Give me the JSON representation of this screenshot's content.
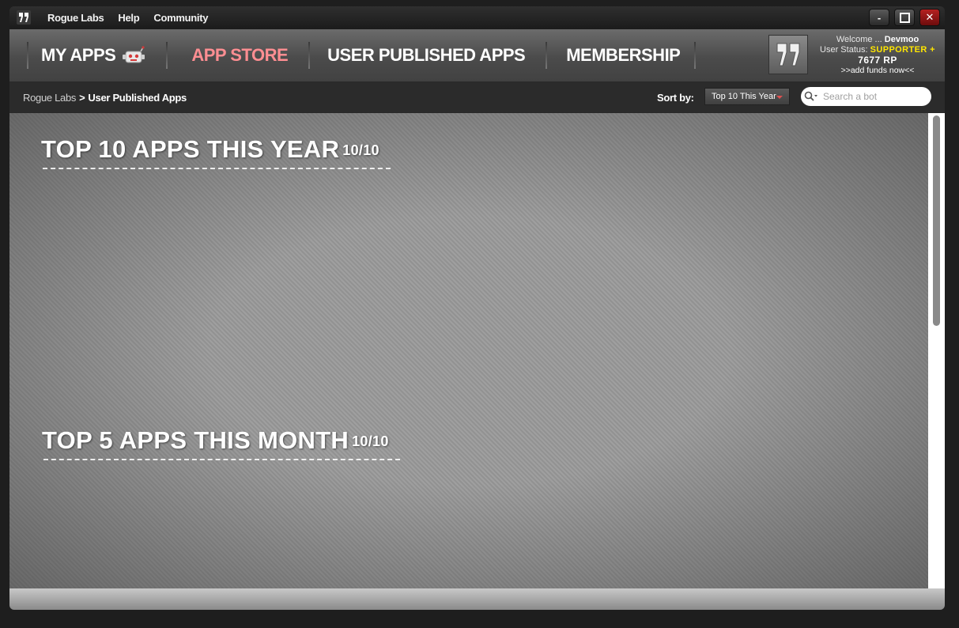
{
  "titlebar": {
    "menu": [
      "Rogue Labs",
      "Help",
      "Community"
    ],
    "controls": {
      "minimize": "-",
      "close": "✕"
    }
  },
  "nav": {
    "tabs": [
      "MY APPS",
      "APP STORE",
      "USER PUBLISHED APPS",
      "MEMBERSHIP"
    ],
    "active_color": "#ff8e92"
  },
  "user": {
    "welcome_label": "Welcome ...",
    "username": "Devmoo",
    "status_label": "User Status:",
    "status": "SUPPORTER +",
    "points": "7677 RP",
    "add_funds": ">>add funds now<<"
  },
  "breadcrumb": {
    "root": "Rogue Labs",
    "separator": ">",
    "current": "User Published Apps"
  },
  "sort": {
    "label": "Sort by:",
    "selected": "Top 10 This Year"
  },
  "search": {
    "placeholder": "Search a bot"
  },
  "sections": [
    {
      "title": "TOP 10 APPS THIS YEAR",
      "count": "10/10"
    },
    {
      "title": "TOP 5 APPS THIS MONTH",
      "count": "10/10"
    }
  ]
}
